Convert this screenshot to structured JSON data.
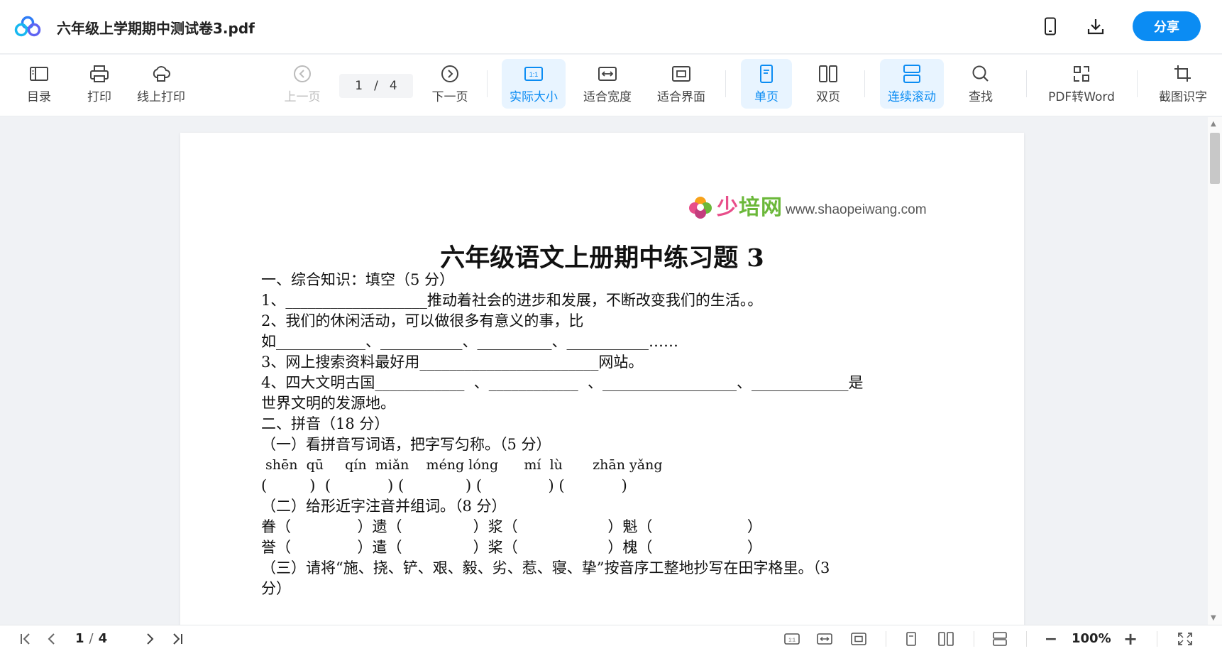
{
  "window": {
    "title": "六年级上学期期中测试卷3.pdf",
    "share_label": "分享",
    "icons": [
      "app-logo-icon",
      "phone-icon",
      "download-icon"
    ]
  },
  "toolbar": {
    "catalog": "目录",
    "print": "打印",
    "online_print": "线上打印",
    "prev_page": "上一页",
    "current_page": "1",
    "page_sep": "/",
    "total_pages": "4",
    "next_page": "下一页",
    "actual_size": "实际大小",
    "fit_width": "适合宽度",
    "fit_screen": "适合界面",
    "single_page": "单页",
    "double_page": "双页",
    "continuous_scroll": "连续滚动",
    "search": "查找",
    "pdf_to_word": "PDF转Word",
    "screenshot_ocr": "截图识字",
    "actual_size_icon_text": "1:1",
    "accent_color": "#0b8cf3"
  },
  "document": {
    "brand_cn_a": "少",
    "brand_cn_b": "培",
    "brand_cn_c": "网",
    "brand_url": "www.shaopeiwang.com",
    "heading": "六年级语文上册期中练习题 3",
    "lines": [
      "一、综合知识：填空（5 分）",
      "1、___________________推动着社会的进步和发展，不断改变我们的生活。。",
      "2、我们的休闲活动，可以做很多有意义的事，比",
      "如____________、___________、__________、___________……",
      "3、网上搜索资料最好用________________________网站。",
      "4、四大文明古国____________  、____________  、__________________、_____________是",
      "世界文明的发源地。",
      "二、拼音（18 分）",
      "（一）看拼音写词语，把字写匀称。（5 分）",
      " shēn  qū     qín  miǎn    méng lóng      mí  lù       zhān yǎng",
      "(         )  (            ) (             ) (              ) (            )",
      "（二）给形近字注音并组词。（8 分）",
      "眷（              ）遗（               ）浆（                   ）魁（                    ）",
      "誉（              ）遣（               ）桨（                   ）槐（                    ）",
      "（三）请将“施、挠、铲、艰、毅、劣、惹、寝、挚”按音序工整地抄写在田字格里。（3",
      "分）"
    ]
  },
  "statusbar": {
    "current_page": "1",
    "page_sep": "/",
    "total_pages": "4",
    "zoom": "100%",
    "zoom_minus": "−",
    "zoom_plus": "+",
    "actual_size_icon_text": "1:1"
  }
}
